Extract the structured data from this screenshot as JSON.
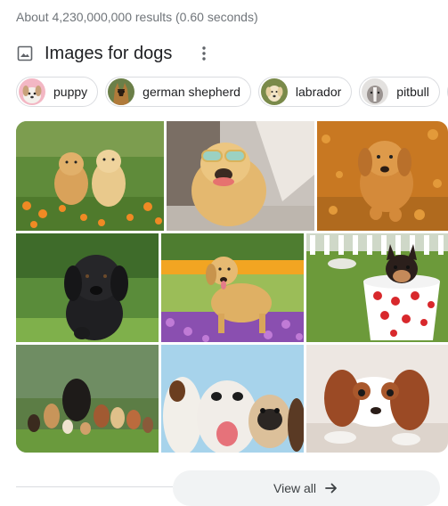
{
  "results_stats": "About 4,230,000,000 results (0.60 seconds)",
  "section": {
    "title": "Images for dogs",
    "more_icon": "vertical-dots-icon",
    "image_icon": "image-icon"
  },
  "chips": [
    {
      "label": "puppy"
    },
    {
      "label": "german shepherd"
    },
    {
      "label": "labrador"
    },
    {
      "label": "pitbull"
    }
  ],
  "images": [
    {
      "subject": "two golden retriever puppies in orange flowers"
    },
    {
      "subject": "golden retriever wearing sunglasses"
    },
    {
      "subject": "golden retriever running through autumn leaves"
    },
    {
      "subject": "black labrador puppy on grass"
    },
    {
      "subject": "golden retriever in flower field"
    },
    {
      "subject": "chihuahua puppy in polka dot cup"
    },
    {
      "subject": "group of many dog breeds on grass"
    },
    {
      "subject": "jack russell, bulldog and pug row"
    },
    {
      "subject": "cavalier king charles spaniel lying down"
    }
  ],
  "footer": {
    "view_all_label": "View all",
    "arrow_icon": "arrow-right-icon"
  }
}
